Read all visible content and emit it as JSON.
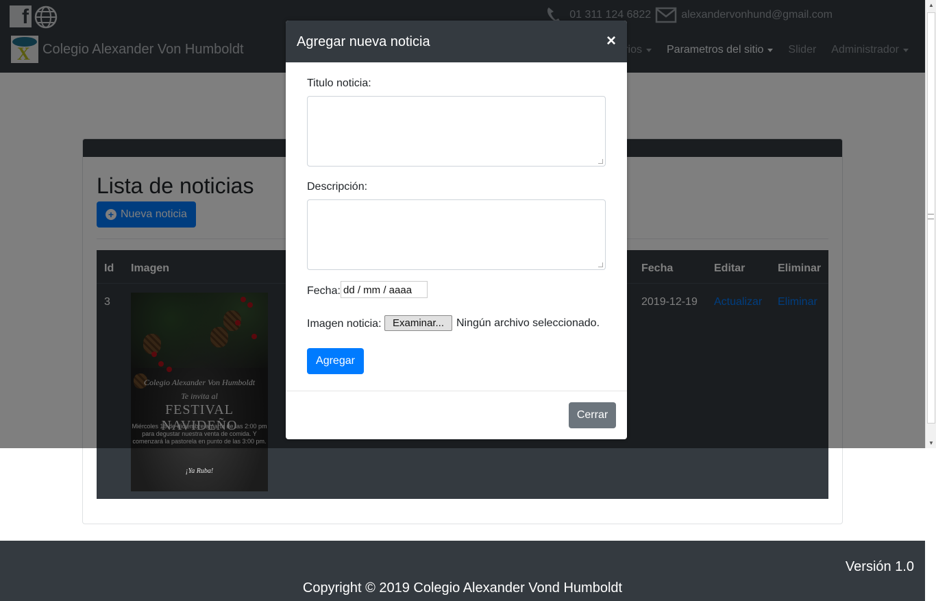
{
  "header": {
    "phone": "01 311 124 6822",
    "email": "alexandervonhund@gmail.com",
    "brand": "Colegio Alexander Von Humboldt",
    "nav": [
      {
        "label": "arios"
      },
      {
        "label": "Parametros del sitio"
      },
      {
        "label": "Slider"
      },
      {
        "label": "Administrador"
      }
    ]
  },
  "page": {
    "title": "Lista de noticias",
    "new_button": "Nueva noticia"
  },
  "table": {
    "columns": [
      "Id",
      "Imagen",
      "Fecha",
      "Editar",
      "Eliminar"
    ],
    "rows": [
      {
        "id": "3",
        "fecha": "2019-12-19",
        "editar": "Actualizar",
        "eliminar": "Eliminar"
      }
    ]
  },
  "poster": {
    "line1": "Colegio Alexander Von Humboldt",
    "line2": "Te invita al",
    "line3": "FESTIVAL NAVIDEÑO",
    "line4": "Miércoles 18 de diciembre a partir de las 2:00 pm para degustar nuestra venta de comida. Y comenzará la pastorela en punto de las 3:00 pm.",
    "line5": "¡Ya Ruba!"
  },
  "footer": {
    "version": "Versión 1.0",
    "copyright": "Copyright © 2019 Colegio Alexander Vond Humboldt"
  },
  "modal": {
    "title": "Agregar nueva noticia",
    "close": "×",
    "titulo_label": "Titulo noticia:",
    "descripcion_label": "Descripción:",
    "fecha_label": "Fecha:",
    "fecha_placeholder": "dd / mm / aaaa",
    "imagen_label": "Imagen noticia:",
    "file_button": "Examinar...",
    "file_status": "Ningún archivo seleccionado.",
    "submit": "Agregar",
    "cerrar": "Cerrar"
  },
  "colors": {
    "dark": "#343a40",
    "primary": "#007bff",
    "secondary": "#6c757d"
  }
}
